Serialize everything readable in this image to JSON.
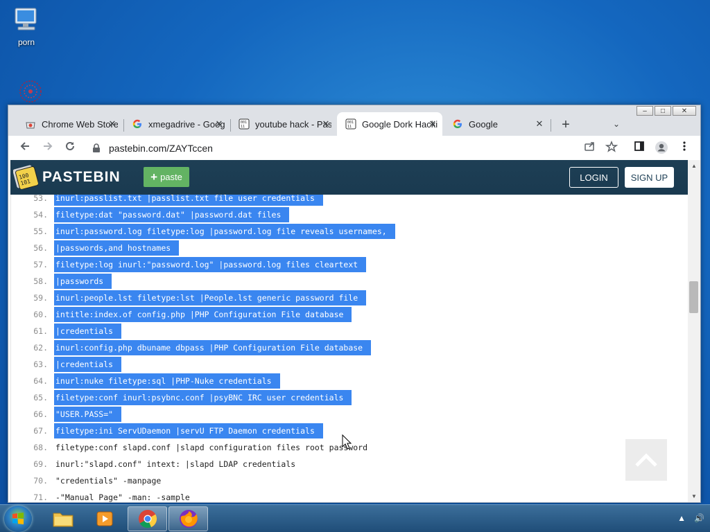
{
  "desktop": {
    "icons": [
      {
        "label": "porn"
      },
      {
        "label": ""
      }
    ]
  },
  "browser": {
    "window_controls": {
      "minimize": "–",
      "maximize": "□",
      "close": "✕"
    },
    "tabs": [
      {
        "title": "Chrome Web Store",
        "icon": "chrome-webstore-icon",
        "active": false
      },
      {
        "title": "xmegadrive - Google Search",
        "icon": "google-g-icon",
        "active": false
      },
      {
        "title": "youtube hack - Pastebin.com",
        "icon": "pastebin-icon",
        "active": false
      },
      {
        "title": "Google Dork Hacking - Pastebin.com",
        "icon": "pastebin-icon",
        "active": true
      },
      {
        "title": "Google",
        "icon": "google-g-icon",
        "active": false
      }
    ],
    "new_tab": "+",
    "tab_search": "⌄",
    "url": "pastebin.com/ZAYTccen"
  },
  "pastebin": {
    "brand": "PASTEBIN",
    "paste_button": "paste",
    "login": "LOGIN",
    "signup": "SIGN UP",
    "lines": [
      {
        "n": "53.",
        "text": "inurl:passlist.txt |passlist.txt file user credentials",
        "selected": true
      },
      {
        "n": "54.",
        "text": "filetype:dat \"password.dat\" |password.dat files",
        "selected": true
      },
      {
        "n": "55.",
        "text": "inurl:password.log filetype:log |password.log file reveals usernames,",
        "selected": true
      },
      {
        "n": "56.",
        "text": "|passwords,and hostnames",
        "selected": true
      },
      {
        "n": "57.",
        "text": "filetype:log inurl:\"password.log\" |password.log files cleartext",
        "selected": true
      },
      {
        "n": "58.",
        "text": "|passwords",
        "selected": true
      },
      {
        "n": "59.",
        "text": "inurl:people.lst filetype:lst |People.lst generic password file",
        "selected": true
      },
      {
        "n": "60.",
        "text": "intitle:index.of config.php |PHP Configuration File database",
        "selected": true
      },
      {
        "n": "61.",
        "text": "|credentials",
        "selected": true
      },
      {
        "n": "62.",
        "text": "inurl:config.php dbuname dbpass |PHP Configuration File database",
        "selected": true
      },
      {
        "n": "63.",
        "text": "|credentials",
        "selected": true
      },
      {
        "n": "64.",
        "text": "inurl:nuke filetype:sql |PHP-Nuke credentials",
        "selected": true
      },
      {
        "n": "65.",
        "text": "filetype:conf inurl:psybnc.conf |psyBNC IRC user credentials",
        "selected": true
      },
      {
        "n": "66.",
        "text": "\"USER.PASS=\"",
        "selected": true
      },
      {
        "n": "67.",
        "text": "filetype:ini ServUDaemon |servU FTP Daemon credentials",
        "selected": true
      },
      {
        "n": "68.",
        "text": "filetype:conf slapd.conf |slapd configuration files root password",
        "selected": false
      },
      {
        "n": "69.",
        "text": "inurl:\"slapd.conf\" intext: |slapd LDAP credentials",
        "selected": false
      },
      {
        "n": "70.",
        "text": "\"credentials\" -manpage",
        "selected": false
      },
      {
        "n": "71.",
        "text": "-\"Manual Page\" -man: -sample",
        "selected": false
      }
    ]
  },
  "taskbar": {
    "apps": [
      {
        "name": "file-explorer-icon"
      },
      {
        "name": "media-player-icon"
      },
      {
        "name": "chrome-icon"
      },
      {
        "name": "firefox-icon"
      }
    ],
    "tray": {
      "arrow": "▲",
      "volume": "🔊"
    }
  }
}
